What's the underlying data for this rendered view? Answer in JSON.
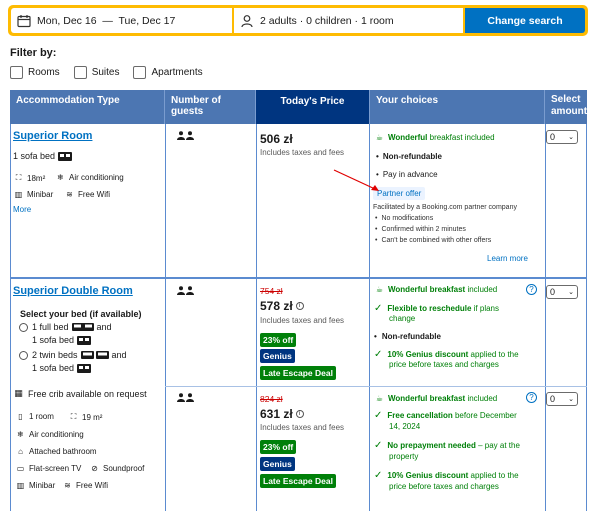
{
  "search": {
    "dates": "Mon, Dec 16  —  Tue, Dec 17",
    "guests": "2 adults · 0 children · 1 room",
    "button": "Change search"
  },
  "filter": {
    "title": "Filter by:",
    "options": [
      "Rooms",
      "Suites",
      "Apartments"
    ]
  },
  "table": {
    "headers": [
      "Accommodation Type",
      "Number of guests",
      "Today's Price",
      "Your choices",
      "Select amount"
    ]
  },
  "rooms": [
    {
      "name": "Superior Room",
      "bed": "1 sofa bed",
      "amenities": [
        "18m²",
        "Air conditioning",
        "Minibar",
        "Free Wifi"
      ],
      "more": "More",
      "price": "506 zł",
      "price_note": "Includes taxes and fees",
      "choices": {
        "breakfast_bold": "Wonderful",
        "breakfast_rest": "breakfast included",
        "line1": "Non-refundable",
        "line2": "Pay in advance",
        "partner_label": "Partner offer",
        "partner_text": "Facilitated by a Booking.com partner company",
        "bullets": [
          "No modifications",
          "Confirmed within 2 minutes",
          "Can't be combined with other offers"
        ],
        "learn_more": "Learn more"
      },
      "select": "0"
    },
    {
      "name": "Superior Double Room",
      "bed_title": "Select your bed (if available)",
      "bed_opt1_a": "1 full bed",
      "bed_opt1_b": "and",
      "bed_opt1_c": "1 sofa bed",
      "bed_opt2_a": "2 twin beds",
      "bed_opt2_b": "and",
      "bed_opt2_c": "1 sofa bed",
      "crib": "Free crib available on request",
      "amenities": [
        "1 room",
        "19 m²",
        "Air conditioning",
        "Attached bathroom",
        "Flat-screen TV",
        "Soundproof",
        "Minibar",
        "Free Wifi"
      ],
      "offers": [
        {
          "old_price": "754 zł",
          "price": "578 zł",
          "price_note": "Includes taxes and fees",
          "discount": "23% off",
          "genius": "Genius",
          "deal": "Late Escape Deal",
          "c1_bold": "Wonderful breakfast",
          "c1_rest": "included",
          "c2_bold": "Flexible to reschedule",
          "c2_rest": "if plans",
          "c2_line2": "change",
          "c3": "Non-refundable",
          "c4_bold": "10% Genius discount",
          "c4_rest": "applied to the",
          "c4_line2": "price before taxes and charges",
          "select": "0"
        },
        {
          "old_price": "824 zł",
          "price": "631 zł",
          "price_note": "Includes taxes and fees",
          "discount": "23% off",
          "genius": "Genius",
          "deal": "Late Escape Deal",
          "c1_bold": "Wonderful breakfast",
          "c1_rest": "included",
          "c2_bold": "Free cancellation",
          "c2_rest": "before December",
          "c2_line2": "14, 2024",
          "c3_bold": "No prepayment needed",
          "c3_rest": "– pay at the",
          "c3_line2": "property",
          "c4_bold": "10% Genius discount",
          "c4_rest": "applied to the",
          "c4_line2": "price before taxes and charges",
          "select": "0"
        }
      ]
    }
  ],
  "colors": {
    "accent": "#0071c2",
    "header_blue": "#4c76b2",
    "price_header": "#003580",
    "search_border": "#febb02",
    "green": "#008009",
    "red": "#cc0000"
  }
}
